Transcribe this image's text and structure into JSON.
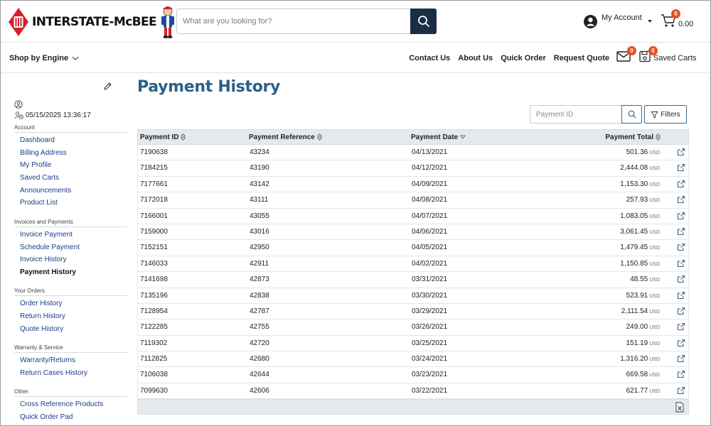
{
  "brand": {
    "name": "INTERSTATE-McBEE"
  },
  "search": {
    "placeholder": "What are you looking for?"
  },
  "account": {
    "label": "My Account"
  },
  "cart": {
    "count": "0",
    "total": "0.00"
  },
  "nav": {
    "shop_by_engine": "Shop by Engine",
    "links": [
      "Contact Us",
      "About Us",
      "Quick Order",
      "Request Quote"
    ],
    "messages_count": "0",
    "saved_carts_label": "Saved Carts",
    "saved_carts_count": "0"
  },
  "sidebar": {
    "datetime": "05/15/2025 13:36:17",
    "sections": [
      {
        "title": "Account",
        "items": [
          "Dashboard",
          "Billing Address",
          "My Profile",
          "Saved Carts",
          "Announcements",
          "Product List"
        ]
      },
      {
        "title": "Invoices and Payments",
        "items": [
          "Invoice Payment",
          "Schedule Payment",
          "Invoice History",
          "Payment History"
        ]
      },
      {
        "title": "Your Orders",
        "items": [
          "Order History",
          "Return History",
          "Quote History"
        ]
      },
      {
        "title": "Warranty & Service",
        "items": [
          "Warranty/Returns",
          "Return Cases History"
        ]
      },
      {
        "title": "Other",
        "items": [
          "Cross Reference Products",
          "Quick Order Pad"
        ]
      }
    ],
    "active_item": "Payment History"
  },
  "page": {
    "title": "Payment History"
  },
  "toolbar": {
    "payment_id_placeholder": "Payment ID",
    "filters_label": "Filters"
  },
  "table": {
    "columns": [
      "Payment ID",
      "Payment Reference",
      "Payment Date",
      "Payment Total"
    ],
    "currency": "USD",
    "rows": [
      {
        "id": "7190638",
        "ref": "43234",
        "date": "04/13/2021",
        "total": "501.36"
      },
      {
        "id": "7184215",
        "ref": "43190",
        "date": "04/12/2021",
        "total": "2,444.08"
      },
      {
        "id": "7177661",
        "ref": "43142",
        "date": "04/09/2021",
        "total": "1,153.30"
      },
      {
        "id": "7172018",
        "ref": "43111",
        "date": "04/08/2021",
        "total": "257.93"
      },
      {
        "id": "7166001",
        "ref": "43055",
        "date": "04/07/2021",
        "total": "1,083.05"
      },
      {
        "id": "7159000",
        "ref": "43016",
        "date": "04/06/2021",
        "total": "3,061.45"
      },
      {
        "id": "7152151",
        "ref": "42950",
        "date": "04/05/2021",
        "total": "1,479.45"
      },
      {
        "id": "7146033",
        "ref": "42911",
        "date": "04/02/2021",
        "total": "1,150.85"
      },
      {
        "id": "7141698",
        "ref": "42873",
        "date": "03/31/2021",
        "total": "48.55"
      },
      {
        "id": "7135196",
        "ref": "42838",
        "date": "03/30/2021",
        "total": "523.91"
      },
      {
        "id": "7128954",
        "ref": "42787",
        "date": "03/29/2021",
        "total": "2,111.54"
      },
      {
        "id": "7122285",
        "ref": "42755",
        "date": "03/26/2021",
        "total": "249.00"
      },
      {
        "id": "7119302",
        "ref": "42720",
        "date": "03/25/2021",
        "total": "151.19"
      },
      {
        "id": "7112825",
        "ref": "42680",
        "date": "03/24/2021",
        "total": "1,316.20"
      },
      {
        "id": "7106038",
        "ref": "42644",
        "date": "03/23/2021",
        "total": "669.58"
      },
      {
        "id": "7099630",
        "ref": "42606",
        "date": "03/22/2021",
        "total": "621.77"
      }
    ]
  },
  "colors": {
    "accent": "#2b5f86",
    "navy": "#1c2e46",
    "badge": "#e8511c",
    "brand_red": "#d6202a",
    "link": "#1a3c8c"
  }
}
